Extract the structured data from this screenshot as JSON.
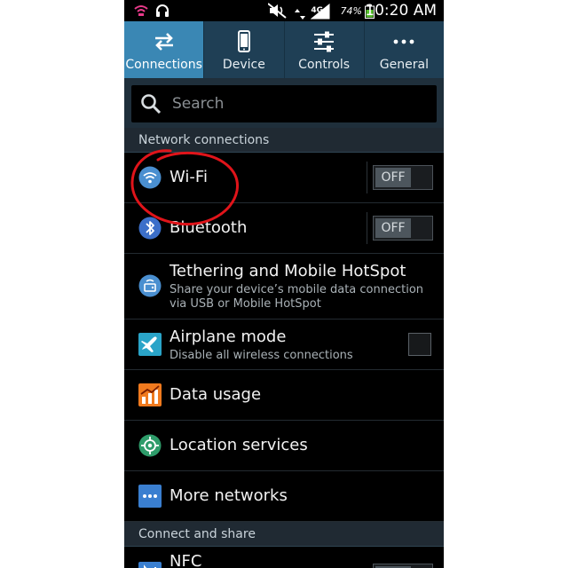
{
  "status_bar": {
    "network_type": "4G",
    "battery_percent": "74%",
    "time": "10:20 AM"
  },
  "tabs": [
    {
      "label": "Connections",
      "icon": "swap-arrows-icon",
      "active": true
    },
    {
      "label": "Device",
      "icon": "phone-icon",
      "active": false
    },
    {
      "label": "Controls",
      "icon": "sliders-icon",
      "active": false
    },
    {
      "label": "General",
      "icon": "more-dots-icon",
      "active": false
    }
  ],
  "search": {
    "placeholder": "Search"
  },
  "sections": {
    "network": "Network connections",
    "connect_share": "Connect and share"
  },
  "items": {
    "wifi": {
      "title": "Wi-Fi",
      "toggle": "OFF"
    },
    "bluetooth": {
      "title": "Bluetooth",
      "toggle": "OFF"
    },
    "tethering": {
      "title": "Tethering and Mobile HotSpot",
      "subtitle": "Share your device’s mobile data connection via USB or Mobile HotSpot"
    },
    "airplane": {
      "title": "Airplane mode",
      "subtitle": "Disable all wireless connections"
    },
    "data_usage": {
      "title": "Data usage"
    },
    "location": {
      "title": "Location services"
    },
    "more_networks": {
      "title": "More networks"
    },
    "nfc": {
      "title": "NFC"
    }
  },
  "colors": {
    "tab_bar": "#1f3f55",
    "tab_active": "#3a87b4",
    "annotation": "#e0141a"
  }
}
